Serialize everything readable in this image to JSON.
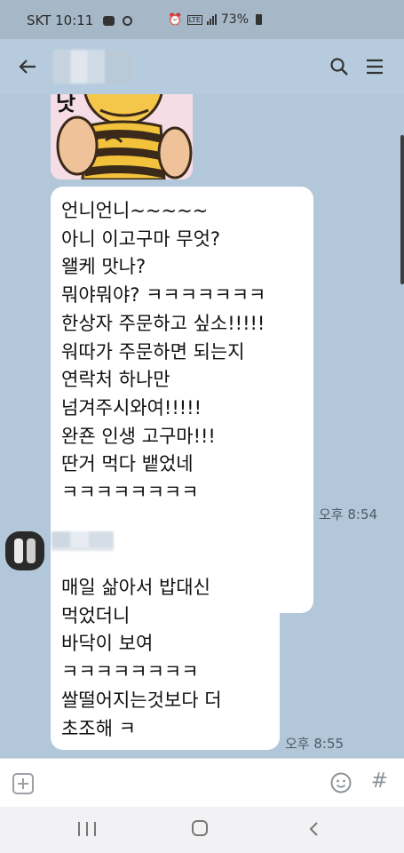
{
  "status_bar": {
    "carrier_time": "SKT 10:11",
    "lte": "LTE",
    "battery": "73%"
  },
  "header": {
    "back_icon": "arrow-left-icon",
    "chat_name": "",
    "search_icon": "search-icon",
    "menu_icon": "hamburger-menu-icon"
  },
  "messages": [
    {
      "lines": [
        "언니언니~~~~~",
        "아니 이고구마 무엇?",
        "왤케 맛나?",
        "뭐야뭐야? ㅋㅋㅋㅋㅋㅋㅋ",
        "한상자 주문하고 싶소!!!!!",
        "워따가 주문하면 되는지",
        "연락처 하나만",
        "넘겨주시와여!!!!!",
        "완죤 인생 고구마!!!",
        "딴거 먹다 뱉었네",
        "ㅋㅋㅋㅋㅋㅋㅋㅋ"
      ],
      "time": "오후 8:54"
    },
    {
      "sender": "",
      "lines": [
        "매일 삶아서 밥대신",
        "먹었더니",
        "바닥이 보여",
        "ㅋㅋㅋㅋㅋㅋㅋㅋ",
        "쌀떨어지는것보다 더",
        "초조해 ㅋ"
      ],
      "time": "오후 8:55"
    }
  ],
  "input_bar": {
    "placeholder": "",
    "hash": "#"
  },
  "colors": {
    "chat_background": "#b2c7da",
    "bubble": "#ffffff",
    "header": "#b6cbde"
  }
}
